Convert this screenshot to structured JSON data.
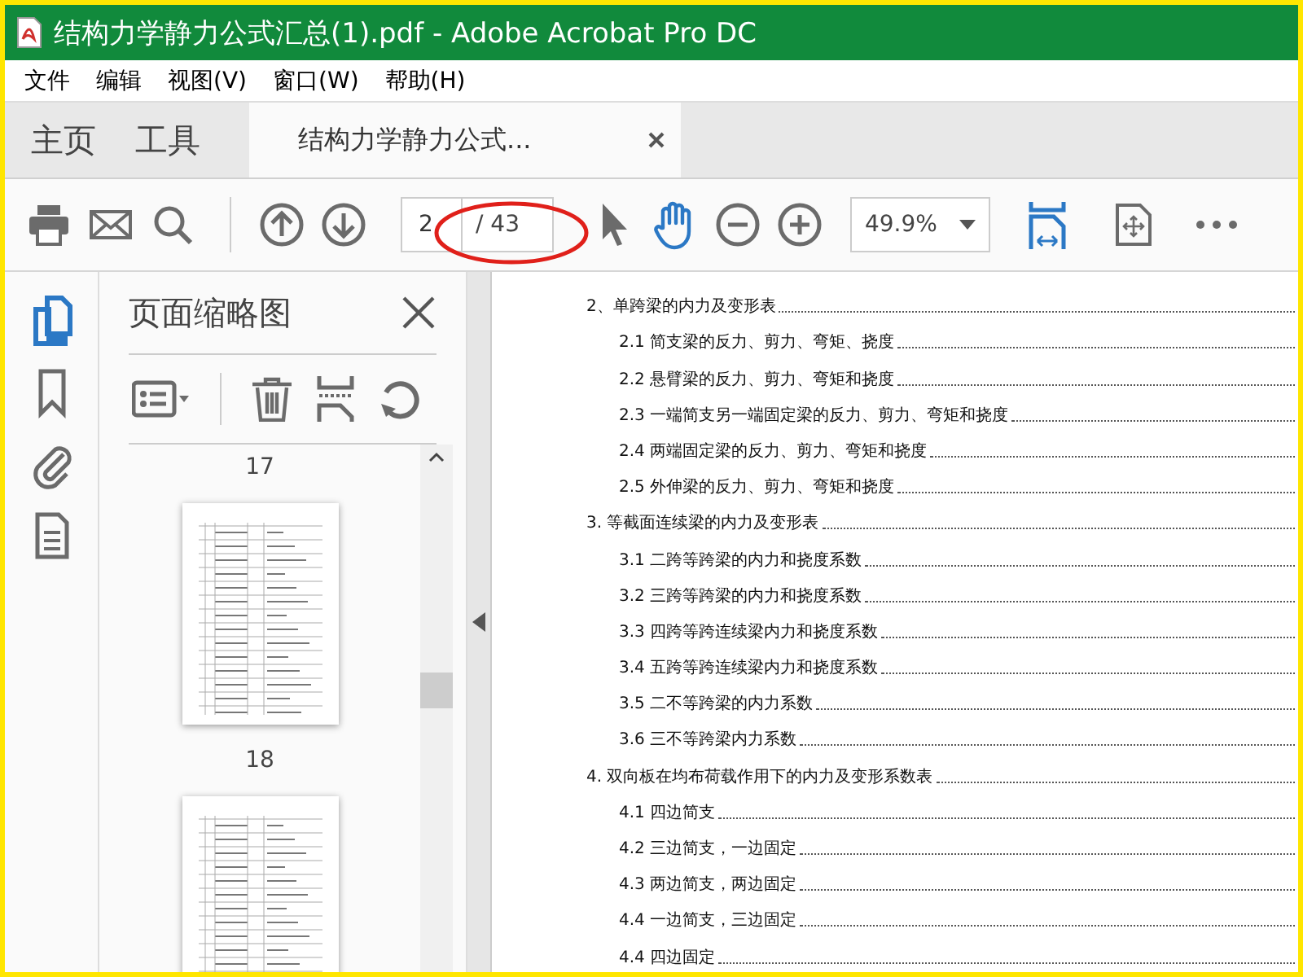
{
  "window": {
    "title": "结构力学静力公式汇总(1).pdf - Adobe Acrobat Pro DC"
  },
  "menu": [
    "文件",
    "编辑",
    "视图(V)",
    "窗口(W)",
    "帮助(H)"
  ],
  "tabs": [
    {
      "label": "主页",
      "kind": "nav",
      "selected": false
    },
    {
      "label": "工具",
      "kind": "nav",
      "selected": false
    },
    {
      "label": "结构力学静力公式...",
      "kind": "document",
      "selected": true
    }
  ],
  "toolbar": {
    "page": {
      "value": "2",
      "total": "/ 43"
    },
    "zoom": {
      "value": "49.9%"
    },
    "tools": [
      {
        "kind": "select",
        "selected": false
      },
      {
        "kind": "hand",
        "selected": true
      }
    ]
  },
  "rail": [
    {
      "kind": "pages",
      "selected": true
    },
    {
      "kind": "bookmarks",
      "selected": false
    },
    {
      "kind": "attachments",
      "selected": false
    },
    {
      "kind": "document",
      "selected": false
    }
  ],
  "thumbnail_panel": {
    "title": "页面缩略图",
    "items": [
      {
        "kind": "label",
        "text": "17"
      },
      {
        "kind": "page"
      },
      {
        "kind": "label",
        "text": "18"
      },
      {
        "kind": "page"
      }
    ]
  },
  "toc": [
    {
      "text": "2、单跨梁的内力及变形表",
      "children": [
        {
          "text": "2.1 简支梁的反力、剪力、弯矩、挠度"
        },
        {
          "text": "2.2 悬臂梁的反力、剪力、弯矩和挠度"
        },
        {
          "text": "2.3 一端简支另一端固定梁的反力、剪力、弯矩和挠度"
        },
        {
          "text": "2.4 两端固定梁的反力、剪力、弯矩和挠度"
        },
        {
          "text": "2.5 外伸梁的反力、剪力、弯矩和挠度"
        }
      ]
    },
    {
      "text": "3. 等截面连续梁的内力及变形表",
      "children": [
        {
          "text": "3.1 二跨等跨梁的内力和挠度系数"
        },
        {
          "text": "3.2 三跨等跨梁的内力和挠度系数"
        },
        {
          "text": "3.3 四跨等跨连续梁内力和挠度系数"
        },
        {
          "text": "3.4 五跨等跨连续梁内力和挠度系数"
        },
        {
          "text": "3.5 二不等跨梁的内力系数"
        },
        {
          "text": "3.6 三不等跨梁内力系数"
        }
      ]
    },
    {
      "text": "4. 双向板在均布荷载作用下的内力及变形系数表",
      "children": [
        {
          "text": "4.1 四边简支"
        },
        {
          "text": "4.2 三边简支，一边固定"
        },
        {
          "text": "4.3 两边简支，两边固定"
        },
        {
          "text": "4.4 一边简支，三边固定"
        },
        {
          "text": "4.4 四边固定"
        }
      ]
    }
  ]
}
